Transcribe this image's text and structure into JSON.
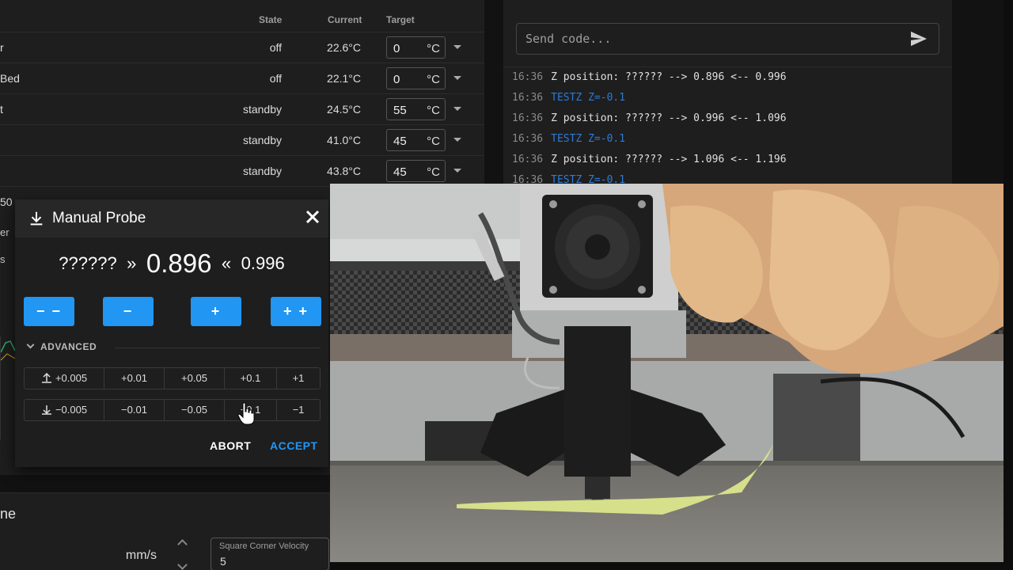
{
  "temperatures": {
    "headers": {
      "state": "State",
      "current": "Current",
      "target": "Target"
    },
    "rows": [
      {
        "name": "r",
        "state": "off",
        "current": "22.6°C",
        "target": "0",
        "unit": "°C"
      },
      {
        "name": "Bed",
        "state": "off",
        "current": "22.1°C",
        "target": "0",
        "unit": "°C"
      },
      {
        "name": "t",
        "state": "standby",
        "current": "24.5°C",
        "target": "55",
        "unit": "°C"
      },
      {
        "name": "",
        "state": "standby",
        "current": "41.0°C",
        "target": "45",
        "unit": "°C"
      },
      {
        "name": "",
        "state": "standby",
        "current": "43.8°C",
        "target": "45",
        "unit": "°C"
      }
    ],
    "partial_row_name": "50"
  },
  "side_fragments": [
    "er",
    "s"
  ],
  "console": {
    "placeholder": "Send code...",
    "lines": [
      {
        "time": "16:36",
        "text": "Z position: ?????? --> 0.896 <-- 0.996",
        "type": "response"
      },
      {
        "time": "16:36",
        "text": "TESTZ Z=-0.1",
        "type": "command"
      },
      {
        "time": "16:36",
        "text": "Z position: ?????? --> 0.996 <-- 1.096",
        "type": "response"
      },
      {
        "time": "16:36",
        "text": "TESTZ Z=-0.1",
        "type": "command"
      },
      {
        "time": "16:36",
        "text": "Z position: ?????? --> 1.096 <-- 1.196",
        "type": "response"
      },
      {
        "time": "16:36",
        "text": "TESTZ Z=-0.1",
        "type": "command"
      }
    ],
    "accent_color": "#2e7bd6"
  },
  "manual_probe": {
    "title": "Manual Probe",
    "position_low": "??????",
    "arrow_left": "»",
    "position_current": "0.896",
    "arrow_right": "«",
    "position_high": "0.996",
    "buttons": [
      "− −",
      "−",
      "+",
      "+ +"
    ],
    "advanced_label": "ADVANCED",
    "raise_steps": [
      "+0.005",
      "+0.01",
      "+0.05",
      "+0.1",
      "+1"
    ],
    "lower_steps": [
      "−0.005",
      "−0.01",
      "−0.05",
      "−0.1",
      "−1"
    ],
    "abort_label": "ABORT",
    "accept_label": "ACCEPT",
    "accent_color": "#2196f3"
  },
  "machine": {
    "title_fragment": "ne",
    "velocity_unit": "mm/s",
    "square_corner_velocity_label": "Square Corner Velocity",
    "square_corner_velocity_value": "5"
  }
}
